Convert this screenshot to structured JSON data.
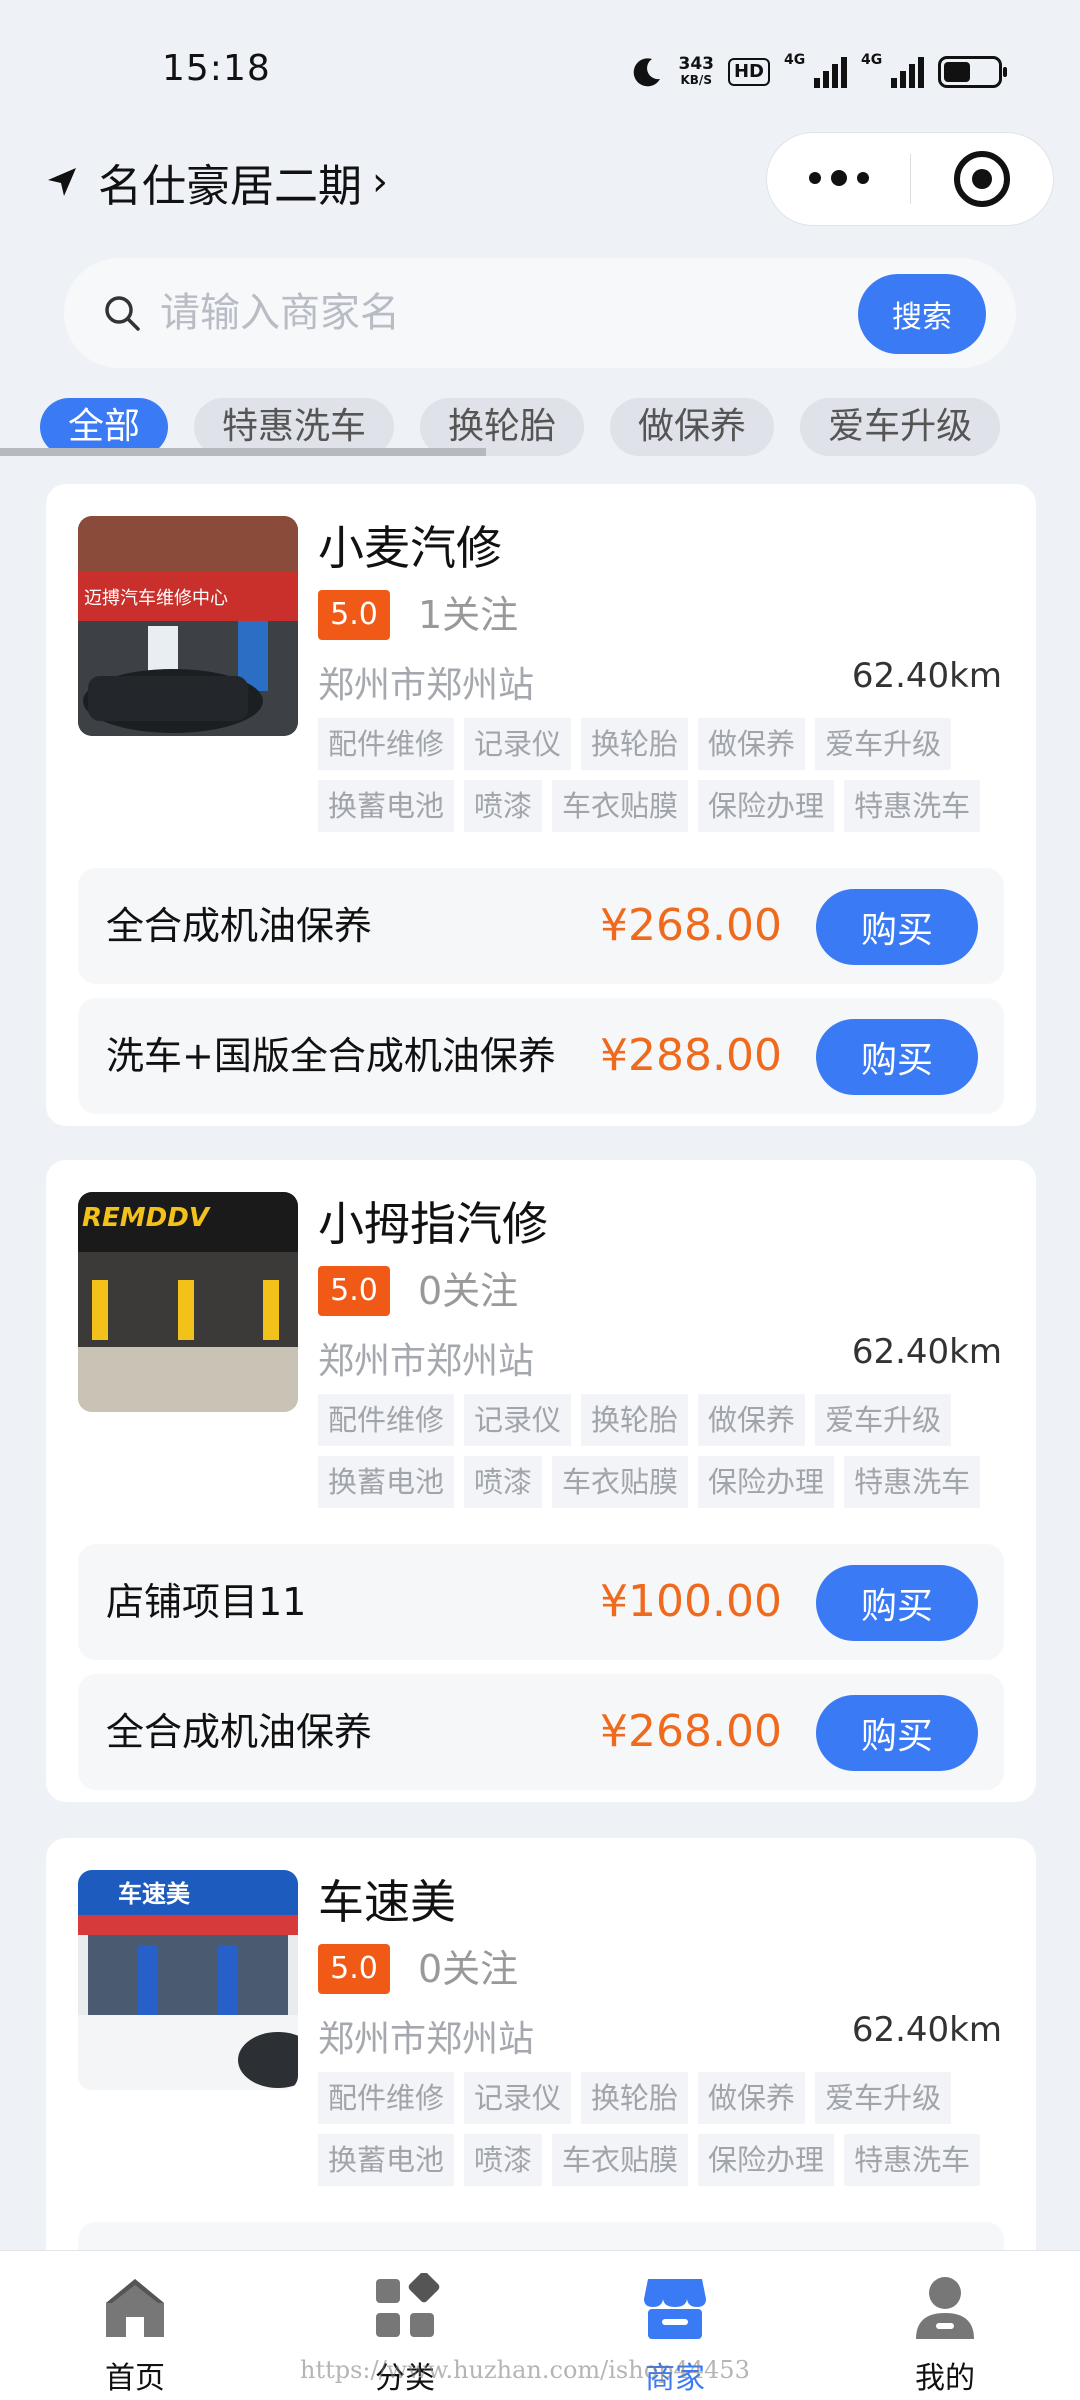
{
  "status_bar": {
    "time": "15:18",
    "net_speed_value": "343",
    "net_speed_unit": "KB/S",
    "hd_badge": "HD",
    "signal_1_label": "4G",
    "signal_2_label": "4G",
    "battery_level": 0.5
  },
  "header": {
    "location_name": "名仕豪居二期",
    "location_chevron": "›"
  },
  "search": {
    "placeholder": "请输入商家名",
    "button_label": "搜索"
  },
  "tabs": [
    "全部",
    "特惠洗车",
    "换轮胎",
    "做保养",
    "爱车升级"
  ],
  "shops": [
    {
      "name": "小麦汽修",
      "rating": "5.0",
      "follow": "1关注",
      "address": "郑州市郑州站",
      "distance": "62.40km",
      "tags": [
        "配件维修",
        "记录仪",
        "换轮胎",
        "做保养",
        "爱车升级",
        "换蓄电池",
        "喷漆",
        "车衣贴膜",
        "保险办理",
        "特惠洗车"
      ],
      "products": [
        {
          "name": "全合成机油保养",
          "price": "¥268.00",
          "buy": "购买"
        },
        {
          "name": "洗车+国版全合成机油保养",
          "price": "¥288.00",
          "buy": "购买"
        }
      ],
      "thumb_sign": "迈搏汽车维修中心"
    },
    {
      "name": "小拇指汽修",
      "rating": "5.0",
      "follow": "0关注",
      "address": "郑州市郑州站",
      "distance": "62.40km",
      "tags": [
        "配件维修",
        "记录仪",
        "换轮胎",
        "做保养",
        "爱车升级",
        "换蓄电池",
        "喷漆",
        "车衣贴膜",
        "保险办理",
        "特惠洗车"
      ],
      "products": [
        {
          "name": "店铺项目11",
          "price": "¥100.00",
          "buy": "购买"
        },
        {
          "name": "全合成机油保养",
          "price": "¥268.00",
          "buy": "购买"
        }
      ],
      "thumb_sign": "REMDDV"
    },
    {
      "name": "车速美",
      "rating": "5.0",
      "follow": "0关注",
      "address": "郑州市郑州站",
      "distance": "62.40km",
      "tags": [
        "配件维修",
        "记录仪",
        "换轮胎",
        "做保养",
        "爱车升级",
        "换蓄电池",
        "喷漆",
        "车衣贴膜",
        "保险办理",
        "特惠洗车"
      ],
      "products": [],
      "thumb_sign": "车速美"
    }
  ],
  "bottom_nav": [
    {
      "label": "首页",
      "icon": "home-icon"
    },
    {
      "label": "分类",
      "icon": "category-icon"
    },
    {
      "label": "商家",
      "icon": "shop-icon"
    },
    {
      "label": "我的",
      "icon": "user-icon"
    }
  ],
  "watermark": "https://www.huzhan.com/ishop44453",
  "colors": {
    "accent": "#3a7bf5",
    "price": "#f06a1e",
    "rating_badge": "#f05a16",
    "background": "#eef1f6"
  }
}
